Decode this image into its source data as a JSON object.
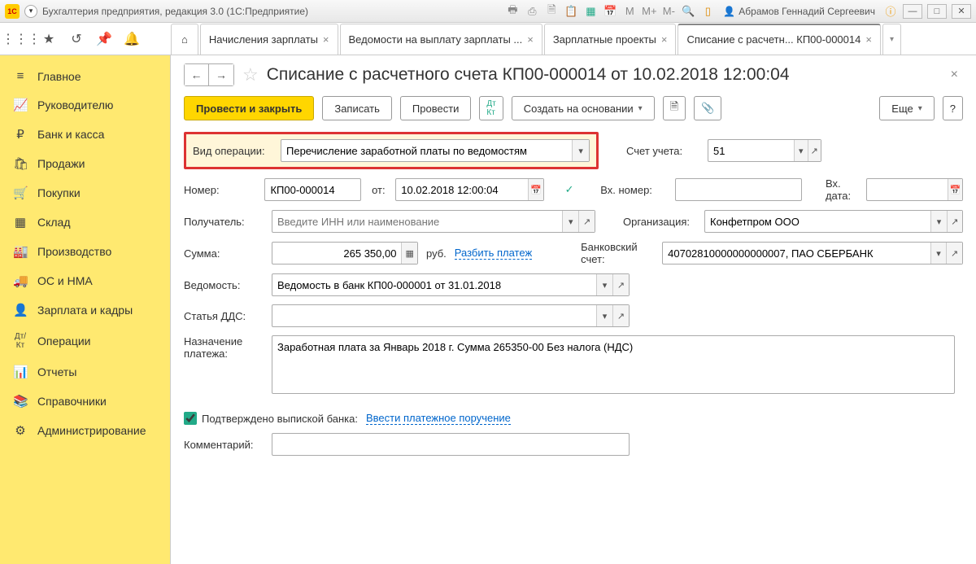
{
  "titlebar": {
    "app_title": "Бухгалтерия предприятия, редакция 3.0  (1С:Предприятие)",
    "user": "Абрамов Геннадий Сергеевич",
    "m_labels": [
      "M",
      "M+",
      "M-"
    ]
  },
  "tabs": [
    {
      "label": "Начисления зарплаты"
    },
    {
      "label": "Ведомости на выплату зарплаты ..."
    },
    {
      "label": "Зарплатные проекты"
    },
    {
      "label": "Списание с расчетн... КП00-000014",
      "active": true
    }
  ],
  "sidebar": [
    {
      "icon": "≡",
      "label": "Главное"
    },
    {
      "icon": "📈",
      "label": "Руководителю"
    },
    {
      "icon": "₽",
      "label": "Банк и касса"
    },
    {
      "icon": "🛍",
      "label": "Продажи"
    },
    {
      "icon": "🛒",
      "label": "Покупки"
    },
    {
      "icon": "▦",
      "label": "Склад"
    },
    {
      "icon": "🏭",
      "label": "Производство"
    },
    {
      "icon": "🚚",
      "label": "ОС и НМА"
    },
    {
      "icon": "👤",
      "label": "Зарплата и кадры"
    },
    {
      "icon": "Дт/Кт",
      "label": "Операции"
    },
    {
      "icon": "📊",
      "label": "Отчеты"
    },
    {
      "icon": "📚",
      "label": "Справочники"
    },
    {
      "icon": "⚙",
      "label": "Администрирование"
    }
  ],
  "doc": {
    "title": "Списание с расчетного счета КП00-000014 от 10.02.2018 12:00:04",
    "buttons": {
      "post_close": "Провести и закрыть",
      "save": "Записать",
      "post": "Провести",
      "create_based": "Создать на основании",
      "more": "Еще",
      "help": "?"
    },
    "fields": {
      "op_type_label": "Вид операции:",
      "op_type_value": "Перечисление заработной платы по ведомостям",
      "account_label": "Счет учета:",
      "account_value": "51",
      "number_label": "Номер:",
      "number_value": "КП00-000014",
      "from_label": "от:",
      "date_value": "10.02.2018 12:00:04",
      "in_number_label": "Вх. номер:",
      "in_date_label": "Вх. дата:",
      "recipient_label": "Получатель:",
      "recipient_ph": "Введите ИНН или наименование",
      "org_label": "Организация:",
      "org_value": "Конфетпром ООО",
      "sum_label": "Сумма:",
      "sum_value": "265 350,00",
      "sum_unit": "руб.",
      "split_link": "Разбить платеж",
      "bank_acc_label": "Банковский счет:",
      "bank_acc_value": "40702810000000000007, ПАО СБЕРБАНК",
      "sheet_label": "Ведомость:",
      "sheet_value": "Ведомость в банк КП00-000001 от 31.01.2018",
      "dds_label": "Статья ДДС:",
      "purpose_label": "Назначение платежа:",
      "purpose_value": "Заработная плата за Январь 2018 г. Сумма 265350-00 Без налога (НДС)",
      "confirm_label": "Подтверждено выпиской банка:",
      "enter_order_link": "Ввести платежное поручение",
      "comment_label": "Комментарий:"
    }
  }
}
